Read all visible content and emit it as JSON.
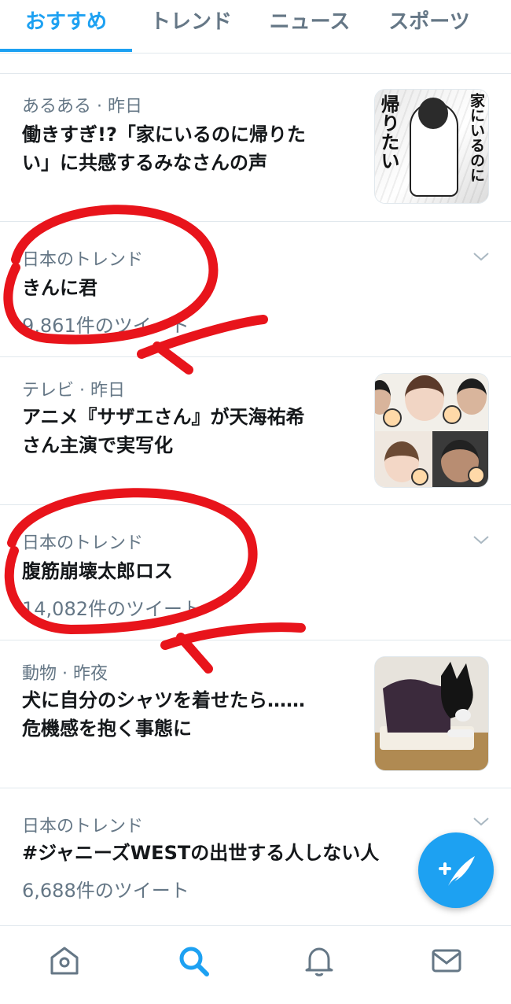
{
  "tabs": [
    {
      "label": "おすすめ",
      "active": true
    },
    {
      "label": "トレンド",
      "active": false
    },
    {
      "label": "ニュース",
      "active": false
    },
    {
      "label": "スポーツ",
      "active": false
    }
  ],
  "feed": [
    {
      "type": "news",
      "meta": "あるある · 昨日",
      "headline_lines": [
        "働きすぎ!?「家にいるのに帰りた",
        "い」に共感するみなさんの声"
      ],
      "thumb": {
        "kind": "manga",
        "text_right": "家にいるのに",
        "text_left": "帰りたい"
      }
    },
    {
      "type": "trend",
      "meta": "日本のトレンド",
      "headline": "きんに君",
      "count": "9,861件のツイート"
    },
    {
      "type": "news",
      "meta": "テレビ · 昨日",
      "headline_lines": [
        "アニメ『サザエさん』が天海祐希",
        "さん主演で実写化"
      ],
      "thumb": {
        "kind": "collage"
      }
    },
    {
      "type": "trend",
      "meta": "日本のトレンド",
      "headline": "腹筋崩壊太郎ロス",
      "count": "14,082件のツイート"
    },
    {
      "type": "news",
      "meta": "動物 · 昨夜",
      "headline_lines": [
        "犬に自分のシャツを着せたら……",
        "危機感を抱く事態に"
      ],
      "thumb": {
        "kind": "dog"
      }
    },
    {
      "type": "trend",
      "meta": "日本のトレンド",
      "headline": "#ジャニーズWESTの出世する人しない人",
      "count": "6,688件のツイート"
    }
  ],
  "icons": {
    "chevron": "chevron-down-icon",
    "fab": "compose-tweet-icon",
    "nav": [
      "home-icon",
      "search-icon",
      "notifications-icon",
      "messages-icon"
    ]
  },
  "colors": {
    "accent": "#1da1f2",
    "text": "#14171a",
    "muted": "#657786",
    "border": "#e1e8ed",
    "annotation": "#e8141b"
  }
}
